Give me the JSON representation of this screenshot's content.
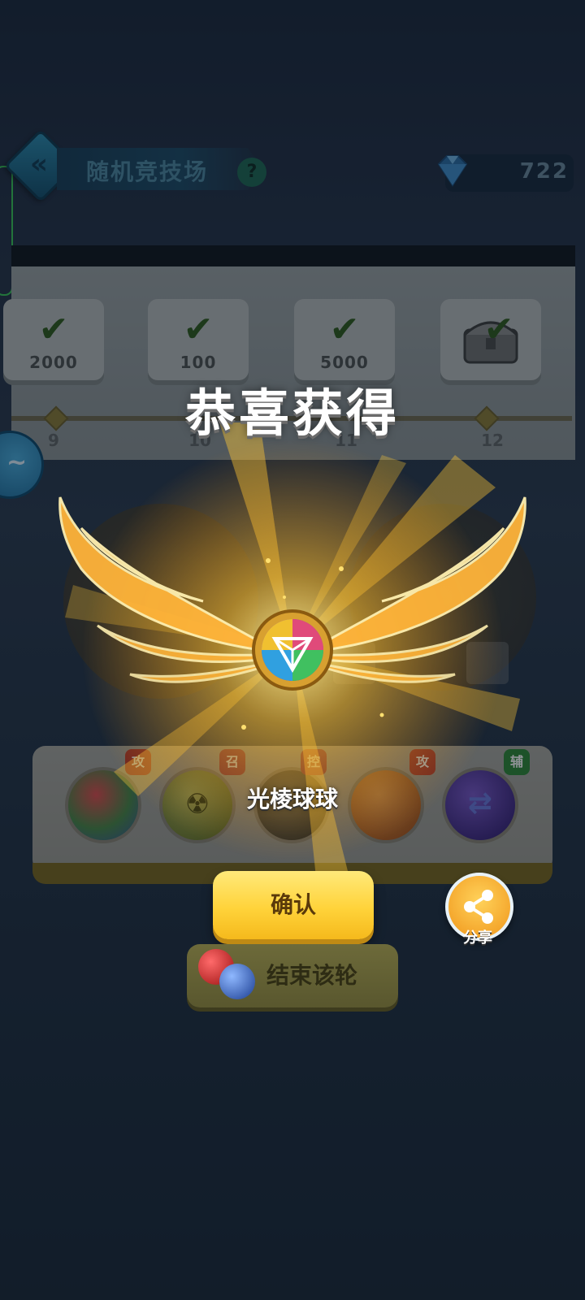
{
  "header": {
    "title": "随机竞技场",
    "help": "?",
    "gems": "722"
  },
  "rewards": {
    "cards": [
      {
        "amount": "2000",
        "claimed": true,
        "icon": "check-icon"
      },
      {
        "amount": "100",
        "claimed": true,
        "icon": "check-icon"
      },
      {
        "amount": "5000",
        "claimed": true,
        "icon": "check-icon"
      },
      {
        "amount": "",
        "claimed": true,
        "icon": "treasure-chest-icon"
      }
    ],
    "milestones": [
      "9",
      "10",
      "11",
      "12"
    ]
  },
  "skills": [
    {
      "name": "prism-ball",
      "tag": "攻",
      "tag_color": "#c0392b"
    },
    {
      "name": "radiation-ball",
      "tag": "召",
      "tag_color": "#a8323e"
    },
    {
      "name": "dark-ball",
      "tag": "控",
      "tag_color": "#a8323e"
    },
    {
      "name": "fire-ball",
      "tag": "攻",
      "tag_color": "#c0392b"
    },
    {
      "name": "swap-ball",
      "tag": "辅",
      "tag_color": "#2e8b3a"
    }
  ],
  "popup": {
    "title": "恭喜获得",
    "item_name": "光棱球球",
    "confirm": "确认",
    "end_round": "结束该轮",
    "share": "分享"
  },
  "colors": {
    "accent_gold": "#ffd33a",
    "glow": "#ffb320"
  }
}
